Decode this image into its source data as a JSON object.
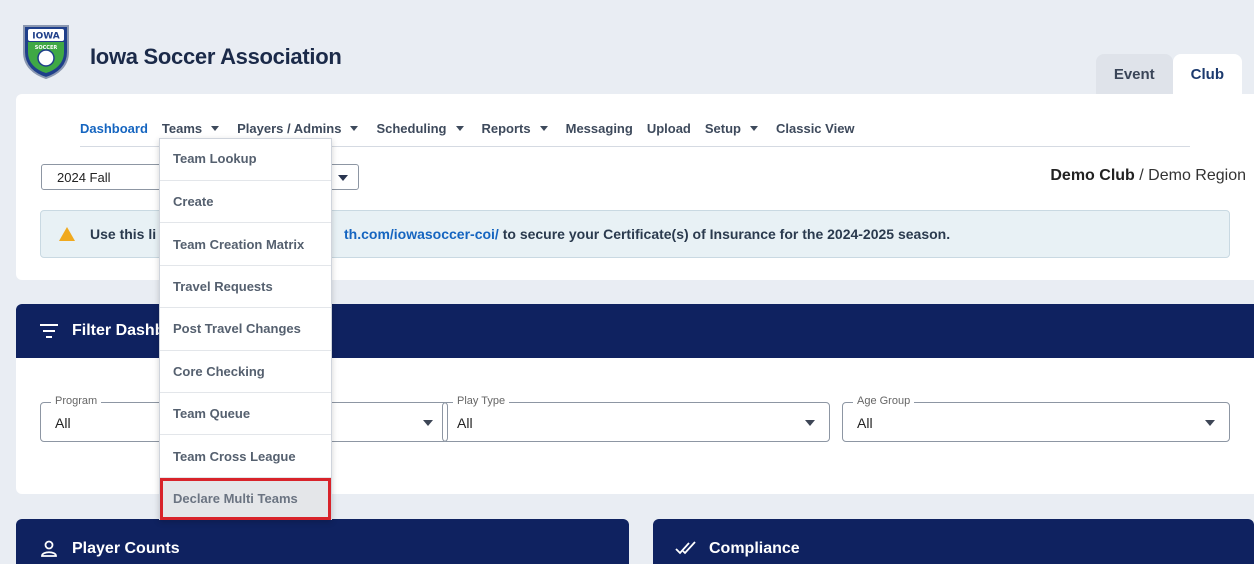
{
  "header": {
    "logo_text": "IOWA",
    "logo_subtext": "SOCCER",
    "org_title": "Iowa Soccer Association",
    "context_tabs": [
      {
        "label": "Event",
        "active": false
      },
      {
        "label": "Club",
        "active": true
      }
    ]
  },
  "nav": {
    "items": [
      {
        "label": "Dashboard",
        "active": true,
        "has_caret": false
      },
      {
        "label": "Teams",
        "active": false,
        "has_caret": true
      },
      {
        "label": "Players / Admins",
        "active": false,
        "has_caret": true
      },
      {
        "label": "Scheduling",
        "active": false,
        "has_caret": true
      },
      {
        "label": "Reports",
        "active": false,
        "has_caret": true
      },
      {
        "label": "Messaging",
        "active": false,
        "has_caret": false
      },
      {
        "label": "Upload",
        "active": false,
        "has_caret": false
      },
      {
        "label": "Setup",
        "active": false,
        "has_caret": true
      },
      {
        "label": "Classic View",
        "active": false,
        "has_caret": false
      }
    ]
  },
  "season_select": {
    "value": "2024 Fall"
  },
  "club_region": {
    "club": "Demo Club",
    "separator": " / ",
    "region": "Demo Region"
  },
  "alert": {
    "text_start": "Use this li",
    "link_text": "th.com/iowasoccer-coi/",
    "text_end": " to secure your Certificate(s) of Insurance for the 2024-2025 season.",
    "icon": "warning-icon",
    "icon_color": "#f0a91e"
  },
  "filter": {
    "title": "Filter Dashb",
    "fields": [
      {
        "label": "Program",
        "value": "All"
      },
      {
        "label": "",
        "value": ""
      },
      {
        "label": "Play Type",
        "value": "All"
      },
      {
        "label": "Age Group",
        "value": "All"
      }
    ]
  },
  "panels": {
    "player_counts": {
      "title": "Player Counts",
      "icon": "person-icon"
    },
    "compliance": {
      "title": "Compliance",
      "icon": "double-check-icon"
    }
  },
  "teams_menu": {
    "items": [
      {
        "label": "Team Lookup"
      },
      {
        "label": "Create"
      },
      {
        "label": "Team Creation Matrix"
      },
      {
        "label": "Travel Requests"
      },
      {
        "label": "Post Travel Changes"
      },
      {
        "label": "Core Checking"
      },
      {
        "label": "Team Queue"
      },
      {
        "label": "Team Cross League"
      },
      {
        "label": "Declare Multi Teams",
        "highlighted": true
      }
    ]
  },
  "colors": {
    "brand_navy": "#0f2260",
    "link_blue": "#1565c0",
    "highlight_red": "#d8232a"
  }
}
